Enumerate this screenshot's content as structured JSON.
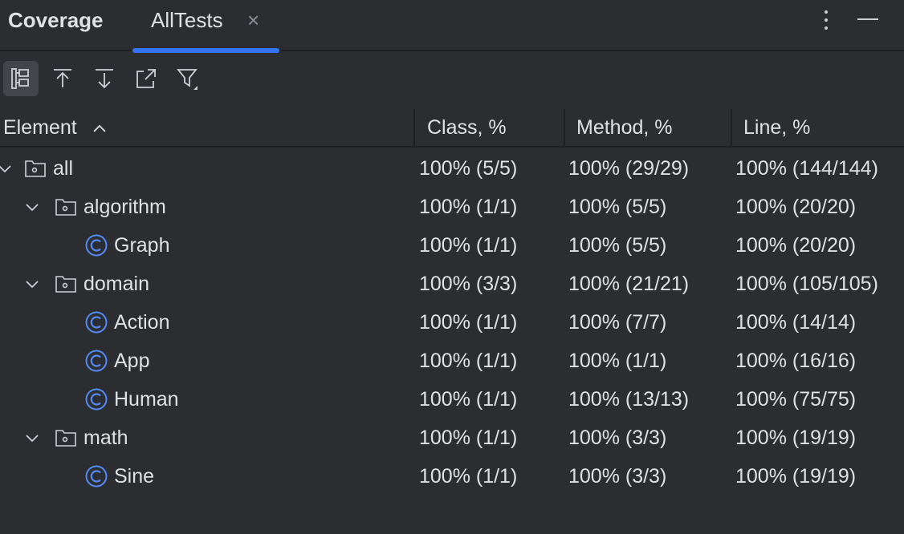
{
  "panel": {
    "title": "Coverage"
  },
  "tab": {
    "label": "AllTests",
    "close": "×"
  },
  "toolbar": {
    "buttons": [
      {
        "name": "flatten-packages-button",
        "icon": "flatten-packages-icon",
        "active": true
      },
      {
        "name": "navigate-up-button",
        "icon": "arrow-up-icon"
      },
      {
        "name": "navigate-down-button",
        "icon": "arrow-down-icon"
      },
      {
        "name": "export-report-button",
        "icon": "export-icon"
      },
      {
        "name": "filter-button",
        "icon": "filter-icon"
      }
    ]
  },
  "table": {
    "columns": [
      "Element",
      "Class, %",
      "Method, %",
      "Line, %"
    ],
    "rows": [
      {
        "name": "all",
        "type": "package",
        "expanded": true,
        "class": "100% (5/5)",
        "method": "100% (29/29)",
        "line": "100% (144/144)"
      },
      {
        "name": "algorithm",
        "type": "package",
        "expanded": true,
        "class": "100% (1/1)",
        "method": "100% (5/5)",
        "line": "100% (20/20)"
      },
      {
        "name": "Graph",
        "type": "class",
        "class": "100% (1/1)",
        "method": "100% (5/5)",
        "line": "100% (20/20)"
      },
      {
        "name": "domain",
        "type": "package",
        "expanded": true,
        "class": "100% (3/3)",
        "method": "100% (21/21)",
        "line": "100% (105/105)"
      },
      {
        "name": "Action",
        "type": "class",
        "class": "100% (1/1)",
        "method": "100% (7/7)",
        "line": "100% (14/14)"
      },
      {
        "name": "App",
        "type": "class",
        "class": "100% (1/1)",
        "method": "100% (1/1)",
        "line": "100% (16/16)"
      },
      {
        "name": "Human",
        "type": "class",
        "class": "100% (1/1)",
        "method": "100% (13/13)",
        "line": "100% (75/75)"
      },
      {
        "name": "math",
        "type": "package",
        "expanded": true,
        "class": "100% (1/1)",
        "method": "100% (3/3)",
        "line": "100% (19/19)"
      },
      {
        "name": "Sine",
        "type": "class",
        "class": "100% (1/1)",
        "method": "100% (3/3)",
        "line": "100% (19/19)"
      }
    ]
  },
  "colors": {
    "background": "#2b2d30",
    "accent": "#3574f0",
    "class_icon": "#548af7",
    "text": "#dfe1e5"
  }
}
